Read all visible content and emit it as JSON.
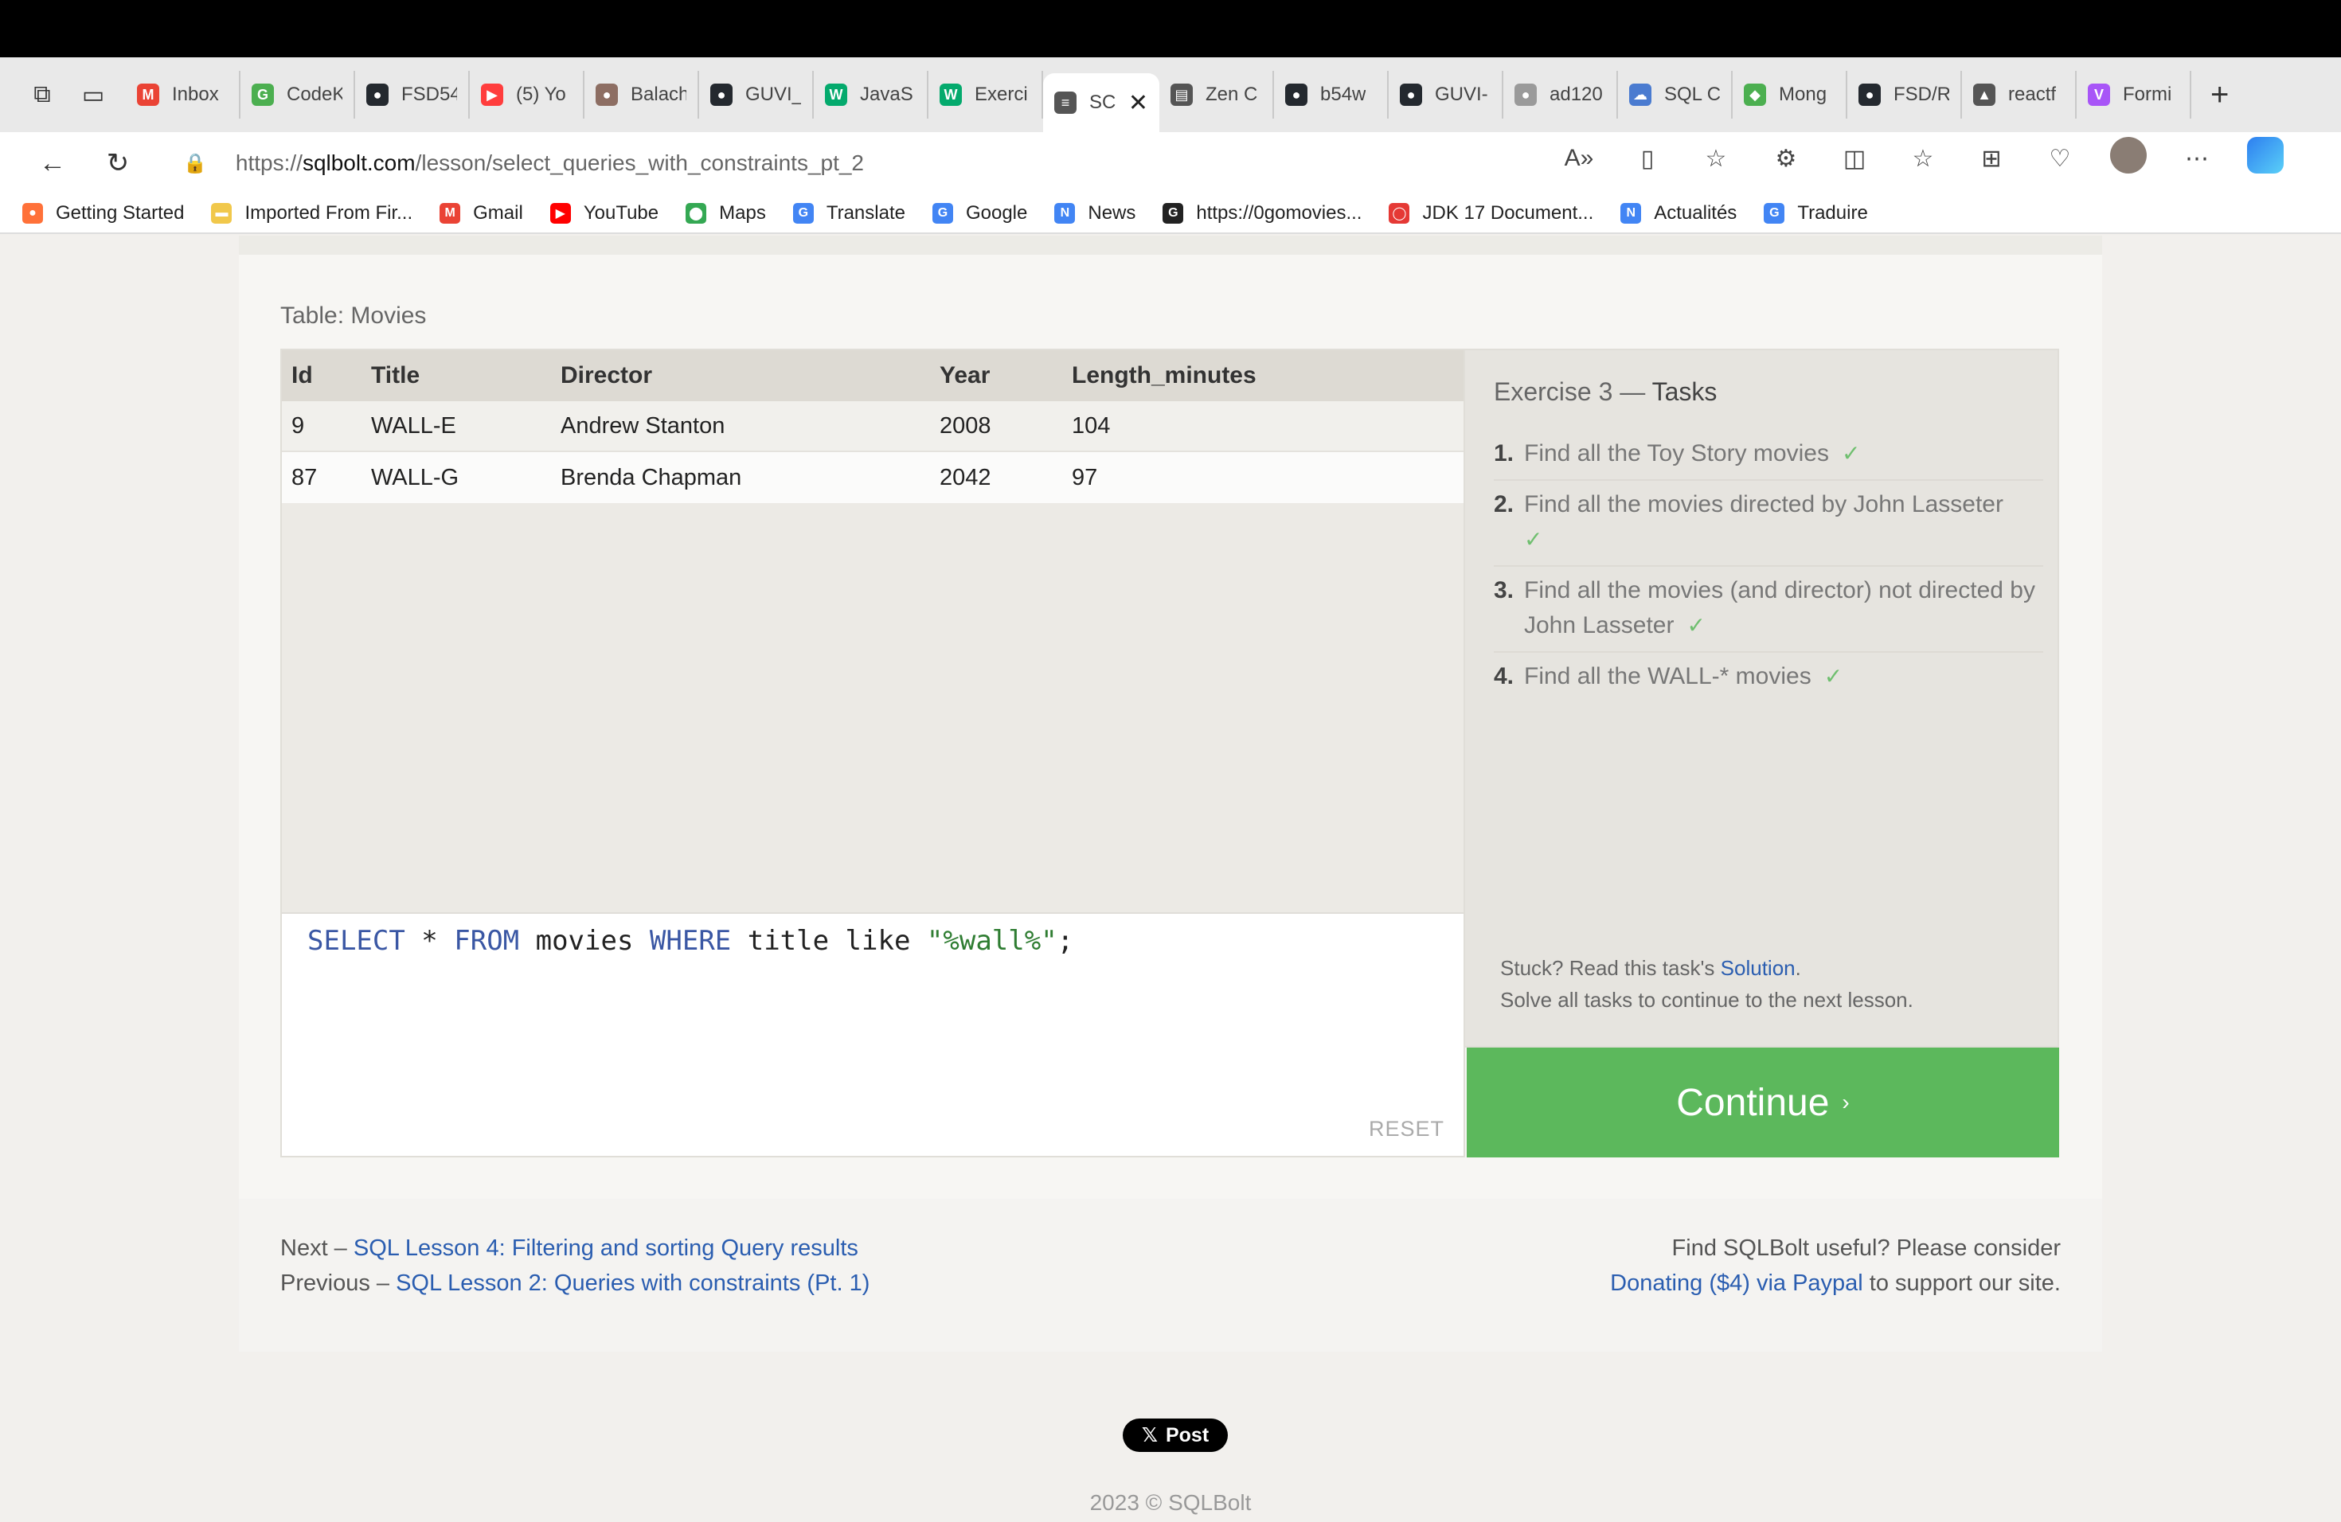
{
  "tabs": [
    {
      "label": "Inbox",
      "icon": "gmail-icon",
      "color": "#ea4335",
      "glyph": "M"
    },
    {
      "label": "CodeK",
      "icon": "codekata-icon",
      "color": "#4caf50",
      "glyph": "G"
    },
    {
      "label": "FSD54",
      "icon": "github-icon",
      "color": "#24292f",
      "glyph": "●"
    },
    {
      "label": "(5) Yo",
      "icon": "youtube-icon",
      "color": "#ff3d3d",
      "glyph": "▶"
    },
    {
      "label": "Balach",
      "icon": "profile-icon",
      "color": "#8d6e63",
      "glyph": "●"
    },
    {
      "label": "GUVI_",
      "icon": "github-icon",
      "color": "#24292f",
      "glyph": "●"
    },
    {
      "label": "JavaS",
      "icon": "w3schools-icon",
      "color": "#04aa6d",
      "glyph": "W"
    },
    {
      "label": "Exerci",
      "icon": "w3schools-icon",
      "color": "#04aa6d",
      "glyph": "W"
    },
    {
      "label": "SC",
      "icon": "database-icon",
      "color": "#555555",
      "glyph": "≡",
      "active": true,
      "close": "✕"
    },
    {
      "label": "Zen C",
      "icon": "zen-icon",
      "color": "#555555",
      "glyph": "▤"
    },
    {
      "label": "b54w",
      "icon": "github-icon",
      "color": "#24292f",
      "glyph": "●"
    },
    {
      "label": "GUVI-",
      "icon": "github-icon",
      "color": "#24292f",
      "glyph": "●"
    },
    {
      "label": "ad120",
      "icon": "github-icon",
      "color": "#9a9a9a",
      "glyph": "●"
    },
    {
      "label": "SQL C",
      "icon": "sql-cloud-icon",
      "color": "#4a7bd0",
      "glyph": "☁"
    },
    {
      "label": "Mong",
      "icon": "mongodb-icon",
      "color": "#4caf50",
      "glyph": "◆"
    },
    {
      "label": "FSD/R",
      "icon": "github-icon",
      "color": "#24292f",
      "glyph": "●"
    },
    {
      "label": "reactf",
      "icon": "react-icon",
      "color": "#555555",
      "glyph": "▲"
    },
    {
      "label": "Formi",
      "icon": "vite-icon",
      "color": "#a855f7",
      "glyph": "V"
    }
  ],
  "address": {
    "protocol": "https://",
    "domain": "sqlbolt.com",
    "path": "/lesson/select_queries_with_constraints_pt_2"
  },
  "bookmarks": [
    {
      "label": "Getting Started",
      "icon": "firefox-icon",
      "color": "#ff7139",
      "glyph": "●"
    },
    {
      "label": "Imported From Fir...",
      "icon": "folder-icon",
      "color": "#f1c84b",
      "glyph": "▬"
    },
    {
      "label": "Gmail",
      "icon": "gmail-icon",
      "color": "#ea4335",
      "glyph": "M"
    },
    {
      "label": "YouTube",
      "icon": "youtube-icon",
      "color": "#ff0000",
      "glyph": "▶"
    },
    {
      "label": "Maps",
      "icon": "maps-icon",
      "color": "#34a853",
      "glyph": "⬤"
    },
    {
      "label": "Translate",
      "icon": "translate-icon",
      "color": "#4285f4",
      "glyph": "G"
    },
    {
      "label": "Google",
      "icon": "google-icon",
      "color": "#4285f4",
      "glyph": "G"
    },
    {
      "label": "News",
      "icon": "news-icon",
      "color": "#4285f4",
      "glyph": "N"
    },
    {
      "label": "https://0gomovies...",
      "icon": "movies-icon",
      "color": "#222222",
      "glyph": "G"
    },
    {
      "label": "JDK 17 Document...",
      "icon": "oracle-icon",
      "color": "#e53935",
      "glyph": "◯"
    },
    {
      "label": "Actualités",
      "icon": "news-icon",
      "color": "#4285f4",
      "glyph": "N"
    },
    {
      "label": "Traduire",
      "icon": "translate-icon",
      "color": "#4285f4",
      "glyph": "G"
    }
  ],
  "table": {
    "label": "Table: Movies",
    "headers": [
      "Id",
      "Title",
      "Director",
      "Year",
      "Length_minutes"
    ],
    "rows": [
      [
        "9",
        "WALL-E",
        "Andrew Stanton",
        "2008",
        "104"
      ],
      [
        "87",
        "WALL-G",
        "Brenda Chapman",
        "2042",
        "97"
      ]
    ]
  },
  "editor": {
    "kw_select": "SELECT",
    "star": " * ",
    "kw_from": "FROM",
    "table_name": " movies ",
    "kw_where": "WHERE",
    "condition": " title like ",
    "string_value": "\"%wall%\"",
    "end": ";",
    "reset_label": "RESET"
  },
  "exercise": {
    "title_prefix": "Exercise 3 — ",
    "title_bold": "Tasks",
    "check": "✓",
    "tasks": [
      {
        "num": "1.",
        "text": "Find all the Toy Story movies"
      },
      {
        "num": "2.",
        "text": "Find all the movies directed by John Lasseter"
      },
      {
        "num": "3.",
        "text": "Find all the movies (and director) not directed by John Lasseter"
      },
      {
        "num": "4.",
        "text": "Find all the WALL-* movies"
      }
    ],
    "stuck_prefix": "Stuck? Read this task's ",
    "solution_link": "Solution",
    "stuck_suffix": ".",
    "solve_all": "Solve all tasks to continue to the next lesson."
  },
  "continue_button": {
    "label": "Continue",
    "chevron": "›"
  },
  "nav": {
    "next_prefix": "Next – ",
    "next_link": "SQL Lesson 4: Filtering and sorting Query results",
    "prev_prefix": "Previous – ",
    "prev_link": "SQL Lesson 2: Queries with constraints (Pt. 1)",
    "useful_text": "Find SQLBolt useful? Please consider",
    "donate_link": "Donating ($4) via Paypal",
    "donate_suffix": " to support our site."
  },
  "x_post": {
    "icon": "x-logo-icon",
    "glyph": "𝕏",
    "label": "Post"
  },
  "copyright": "2023 © SQLBolt",
  "colors": {
    "accent_green": "#5cb85c",
    "link_blue": "#2a5db0",
    "keyword_blue": "#3a57a4",
    "string_green": "#2f7d32"
  }
}
